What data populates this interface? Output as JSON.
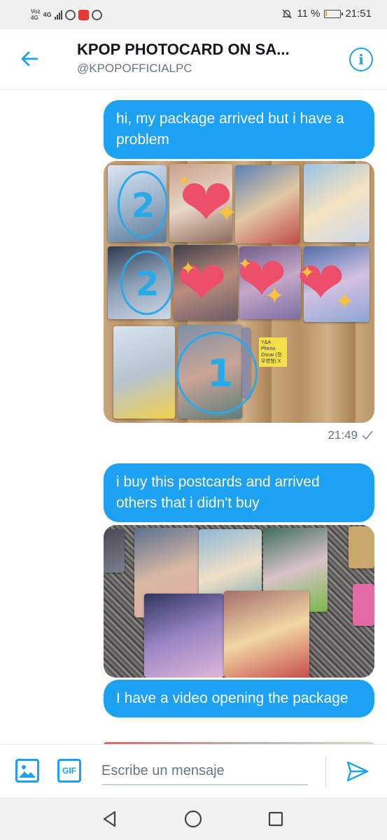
{
  "status_bar": {
    "carrier": "Voz",
    "network_top": "4G",
    "network": "4G",
    "battery": "11 %",
    "battery_level": 0.11,
    "time": "21:51"
  },
  "header": {
    "title": "KPOP PHOTOCARD ON SA...",
    "handle": "@KPOPOFFICIALPC"
  },
  "messages": [
    {
      "type": "text",
      "text": "hi, my package arrived but i have a problem"
    },
    {
      "type": "image",
      "time": "21:49",
      "annotations": [
        "2",
        "2",
        "1"
      ],
      "sticky_note": "Y&A Pheno Oscar (정우영형) X"
    },
    {
      "type": "text",
      "text": "i buy this postcards and arrived others that i didn't buy"
    },
    {
      "type": "image"
    },
    {
      "type": "text",
      "text": "I have a video opening the package"
    }
  ],
  "composer": {
    "placeholder": "Escribe un mensaje",
    "gif_label": "GIF"
  },
  "colors": {
    "accent": "#1da1f2",
    "heart": "#ec4e6c",
    "sparkle": "#f9c23c",
    "annotation": "#29a9e8"
  },
  "icons": {
    "back": "arrow-left-icon",
    "info": "info-icon",
    "image": "image-icon",
    "gif": "gif-icon",
    "send": "send-icon",
    "nav_back": "triangle-back-icon",
    "nav_home": "circle-home-icon",
    "nav_recent": "square-recent-icon"
  }
}
